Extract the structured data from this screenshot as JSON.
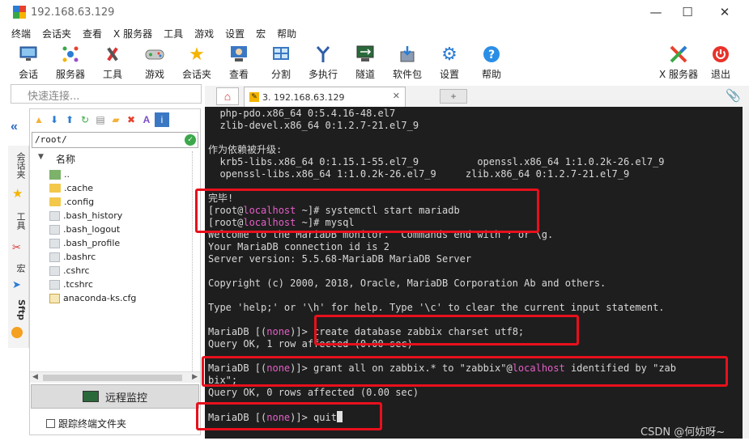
{
  "window": {
    "title": "192.168.63.129",
    "controls": {
      "minimize": "—",
      "maximize": "☐",
      "close": "✕"
    }
  },
  "menu": [
    "终端",
    "会话夹",
    "查看",
    "X 服务器",
    "工具",
    "游戏",
    "设置",
    "宏",
    "帮助"
  ],
  "toolbar": {
    "items": [
      {
        "label": "会话",
        "icon": "session-icon"
      },
      {
        "label": "服务器",
        "icon": "servers-icon"
      },
      {
        "label": "工具",
        "icon": "tools-icon"
      },
      {
        "label": "游戏",
        "icon": "games-icon"
      },
      {
        "label": "会话夹",
        "icon": "star-icon"
      },
      {
        "label": "查看",
        "icon": "view-icon"
      },
      {
        "label": "分割",
        "icon": "split-icon"
      },
      {
        "label": "多执行",
        "icon": "multiexec-icon"
      },
      {
        "label": "隧道",
        "icon": "tunnel-icon"
      },
      {
        "label": "软件包",
        "icon": "packages-icon"
      },
      {
        "label": "设置",
        "icon": "settings-icon"
      },
      {
        "label": "帮助",
        "icon": "help-icon"
      }
    ],
    "right_items": [
      {
        "label": "X 服务器",
        "icon": "xserver-icon"
      },
      {
        "label": "退出",
        "icon": "exit-icon"
      }
    ]
  },
  "quick_connect": {
    "placeholder": "快速连接..."
  },
  "side_tabs": [
    "会话夹",
    "工具",
    "宏",
    "Sftp"
  ],
  "file_panel": {
    "path": "/root/",
    "column_header": "名称",
    "items": [
      {
        "name": "..",
        "type": "up"
      },
      {
        "name": ".cache",
        "type": "folder"
      },
      {
        "name": ".config",
        "type": "folder"
      },
      {
        "name": ".bash_history",
        "type": "file"
      },
      {
        "name": ".bash_logout",
        "type": "file"
      },
      {
        "name": ".bash_profile",
        "type": "file"
      },
      {
        "name": ".bashrc",
        "type": "file"
      },
      {
        "name": ".cshrc",
        "type": "file"
      },
      {
        "name": ".tcshrc",
        "type": "file"
      },
      {
        "name": "anaconda-ks.cfg",
        "type": "file"
      }
    ],
    "remote_monitor_label": "远程监控",
    "follow_terminal_label": "跟踪终端文件夹"
  },
  "tabs": {
    "active_label": "3. 192.168.63.129"
  },
  "terminal": {
    "lines": [
      [
        {
          "t": "  php-pdo.x86_64 0:5.4.16-48.el7"
        }
      ],
      [
        {
          "t": "  zlib-devel.x86_64 0:1.2.7-21.el7_9"
        }
      ],
      [
        {
          "t": ""
        }
      ],
      [
        {
          "t": "作为依赖被升级:"
        }
      ],
      [
        {
          "t": "  krb5-libs.x86_64 0:1.15.1-55.el7_9          openssl.x86_64 1:1.0.2k-26.el7_9"
        }
      ],
      [
        {
          "t": "  openssl-libs.x86_64 1:1.0.2k-26.el7_9     zlib.x86_64 0:1.2.7-21.el7_9"
        }
      ],
      [
        {
          "t": ""
        }
      ],
      [
        {
          "t": "完毕!"
        }
      ],
      [
        {
          "t": "[root@"
        },
        {
          "t": "localhost",
          "c": "ho"
        },
        {
          "t": " ~]# systemctl start mariadb"
        }
      ],
      [
        {
          "t": "[root@"
        },
        {
          "t": "localhost",
          "c": "ho"
        },
        {
          "t": " ~]# mysql"
        }
      ],
      [
        {
          "t": "Welcome to the MariaDB monitor.  Commands end with ; or \\g."
        }
      ],
      [
        {
          "t": "Your MariaDB connection id is 2"
        }
      ],
      [
        {
          "t": "Server version: 5.5.68-MariaDB MariaDB Server"
        }
      ],
      [
        {
          "t": ""
        }
      ],
      [
        {
          "t": "Copyright (c) 2000, 2018, Oracle, MariaDB Corporation Ab and others."
        }
      ],
      [
        {
          "t": ""
        }
      ],
      [
        {
          "t": "Type 'help;' or '\\h' for help. Type '\\c' to clear the current input statement."
        }
      ],
      [
        {
          "t": ""
        }
      ],
      [
        {
          "t": "MariaDB [("
        },
        {
          "t": "none",
          "c": "ho"
        },
        {
          "t": ")]> create database zabbix charset utf8;"
        }
      ],
      [
        {
          "t": "Query OK, 1 row affected (0.00 sec)"
        }
      ],
      [
        {
          "t": ""
        }
      ],
      [
        {
          "t": "MariaDB [("
        },
        {
          "t": "none",
          "c": "ho"
        },
        {
          "t": ")]> grant all on zabbix.* to \"zabbix\"@"
        },
        {
          "t": "localhost",
          "c": "ho"
        },
        {
          "t": " identified by \"zab"
        }
      ],
      [
        {
          "t": "bix\";"
        }
      ],
      [
        {
          "t": "Query OK, 0 rows affected (0.00 sec)"
        }
      ],
      [
        {
          "t": ""
        }
      ],
      [
        {
          "t": "MariaDB [("
        },
        {
          "t": "none",
          "c": "ho"
        },
        {
          "t": ")]> quit"
        },
        {
          "cursor": true
        }
      ]
    ]
  },
  "watermark": "CSDN @何妨呀~",
  "colors": {
    "terminal_bg": "#1e1e1e",
    "terminal_fg": "#d8d8d8",
    "hostname": "#e45fc8",
    "highlight_box": "#e8101c"
  }
}
